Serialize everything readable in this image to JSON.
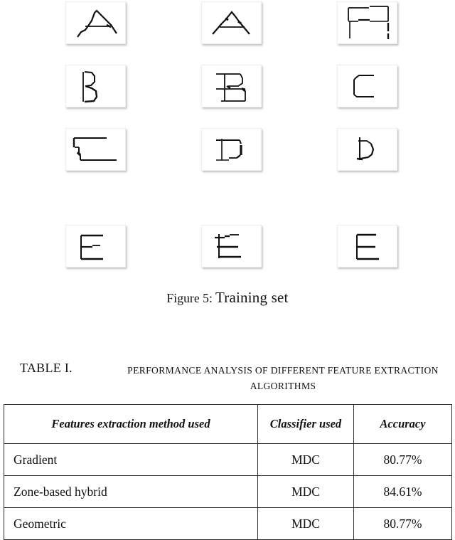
{
  "figure": {
    "caption_label": "Figure 5:",
    "caption_title": "Training set",
    "grid": {
      "rows": 4,
      "cols": 3,
      "samples": [
        {
          "index": 1,
          "row": 1,
          "col": 1,
          "character": "A",
          "alt": "handwritten-letter-A"
        },
        {
          "index": 2,
          "row": 1,
          "col": 2,
          "character": "A",
          "alt": "handwritten-letter-A"
        },
        {
          "index": 3,
          "row": 1,
          "col": 3,
          "character": "A",
          "alt": "handwritten-letter-A"
        },
        {
          "index": 4,
          "row": 2,
          "col": 1,
          "character": "B",
          "alt": "handwritten-letter-B"
        },
        {
          "index": 5,
          "row": 2,
          "col": 2,
          "character": "B",
          "alt": "handwritten-letter-B"
        },
        {
          "index": 6,
          "row": 2,
          "col": 3,
          "character": "C",
          "alt": "handwritten-letter-C"
        },
        {
          "index": 7,
          "row": 3,
          "col": 1,
          "character": "C",
          "alt": "handwritten-letter-C"
        },
        {
          "index": 8,
          "row": 3,
          "col": 2,
          "character": "D",
          "alt": "handwritten-letter-D"
        },
        {
          "index": 9,
          "row": 3,
          "col": 3,
          "character": "D",
          "alt": "handwritten-letter-D"
        },
        {
          "index": 10,
          "row": 4,
          "col": 1,
          "character": "E",
          "alt": "handwritten-letter-E"
        },
        {
          "index": 11,
          "row": 4,
          "col": 2,
          "character": "E",
          "alt": "handwritten-letter-E"
        },
        {
          "index": 12,
          "row": 4,
          "col": 3,
          "character": "E",
          "alt": "handwritten-letter-E"
        }
      ]
    }
  },
  "table_caption": {
    "number": "TABLE I.",
    "title": "PERFORMANCE ANALYSIS OF DIFFERENT FEATURE EXTRACTION ALGORITHMS"
  },
  "table": {
    "headers": [
      "Features extraction method used",
      "Classifier used",
      "Accuracy"
    ],
    "rows": [
      {
        "method": "Gradient",
        "classifier": "MDC",
        "accuracy": "80.77%"
      },
      {
        "method": "Zone-based hybrid",
        "classifier": "MDC",
        "accuracy": "84.61%"
      },
      {
        "method": "Geometric",
        "classifier": "MDC",
        "accuracy": "80.77%"
      }
    ]
  },
  "colors": {
    "page_background": "#ffffff",
    "ink": "#111111",
    "table_border": "#2a2a2a",
    "stroke": "#101010"
  }
}
